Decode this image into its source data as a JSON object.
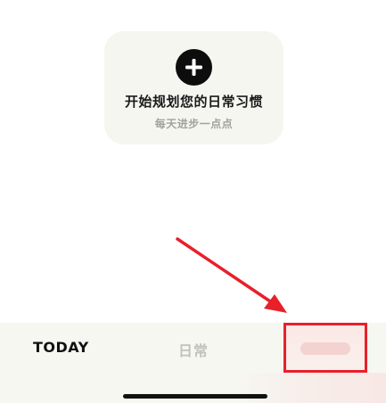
{
  "empty_state": {
    "add_icon": "plus-icon",
    "title": "开始规划您的日常习惯",
    "subtitle": "每天进步一点点"
  },
  "annotation": {
    "arrow_color": "#e8202a",
    "highlight_color": "#e8202a"
  },
  "tab_bar": {
    "tabs": [
      {
        "label": "TODAY",
        "active": true
      },
      {
        "label": "日常",
        "active": false
      },
      {
        "label": "",
        "active": false
      }
    ]
  },
  "colors": {
    "card_background": "#f6f6f1",
    "tab_bar_background": "#f7f7f2",
    "active_tab": "#111111",
    "inactive_tab": "#c2c2bc"
  }
}
